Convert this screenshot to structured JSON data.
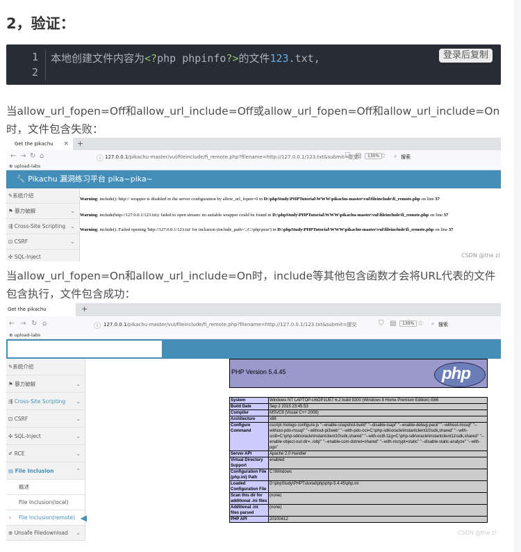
{
  "heading": "2，验证：",
  "code": {
    "line_numbers": [
      "1",
      "2"
    ],
    "text_prefix": "本地创建文件内容为",
    "open_tag": "<?",
    "php_code": "php phpinfo",
    "close_tag": "?>",
    "text_mid": "的文件",
    "file_num": "123",
    "file_ext": ".txt,",
    "copy_label": "登录后复制"
  },
  "para1": "当allow_url_fopen=Off和allow_url_include=Off或allow_url_fopen=Off和allow_url_include=On时，文件包含失败：",
  "para2": "当allow_url_fopen=On和allow_url_include=On时，include等其他包含函数才会将URL代表的文件包含执行，文件包含成功：",
  "shot1": {
    "tab_title": "Get the pikachu",
    "tab_close": "×",
    "tab_plus": "+",
    "url_host": "127.0.0.1",
    "url_path": "/pikachu-master/vul/fileinclude/fi_remote.php?filename=http://127.0.0.1/123.txt&submit=提交",
    "zoom": "130%",
    "search": "搜索",
    "bookmark": "upload-labs",
    "banner": "Pikachu 漏洞练习平台 pika~pika~",
    "sidebar": [
      "系统介绍",
      "暴力破解",
      "Cross-Site Scripting",
      "CSRF",
      "SQL-Inject"
    ],
    "warnings": [
      {
        "label": "Warning",
        "msg": ": include(): http:// wrapper is disabled in the server configuration by allow_url_fopen=0 in ",
        "file": "D:\\phpStudy\\PHPTutorial\\WWW\\pikachu-master\\vul\\fileinclude\\fi_remote.php",
        "line_text": " on line ",
        "line": "37"
      },
      {
        "label": "Warning",
        "msg": ": include(http://127.0.0.1/123.txt): failed to open stream: no suitable wrapper could be found in ",
        "file": "D:\\phpStudy\\PHPTutorial\\WWW\\pikachu-master\\vul\\fileinclude\\fi_remote.php",
        "line_text": " on line ",
        "line": "37"
      },
      {
        "label": "Warning",
        "msg": ": include(): Failed opening 'http://127.0.0.1/123.txt' for inclusion (include_path='.;C:\\php\\pear') in ",
        "file": "D:\\phpStudy\\PHPTutorial\\WWW\\pikachu-master\\vul\\fileinclude\\fi_remote.php",
        "line_text": " on line ",
        "line": "37"
      }
    ],
    "watermark": "CSDN @the zl"
  },
  "shot2": {
    "tab_title": "Get the pikachu",
    "tab_plus": "+",
    "url_host": "127.0.0.1",
    "url_path": "/pikachu-master/vul/fileinclude/fi_remote.php?filename=http://127.0.0.1/123.txt&submit=提交",
    "zoom": "130%",
    "search": "搜索",
    "bookmark": "upload-labs",
    "sidebar": [
      "系统介绍",
      "暴力破解",
      "Cross-Site Scripting",
      "CSRF",
      "SQL-Inject",
      "RCE",
      "File Inclusion"
    ],
    "submenu": [
      "概述",
      "File Inclusion(local)",
      "File Inclusion(remote)"
    ],
    "sidebar_last": "Unsafe Filedownload",
    "php_version": "PHP Version 5.4.45",
    "php_logo": "php",
    "php_rows": [
      {
        "k": "System",
        "v": "Windows NT LAPTOP-U6OP1UE7 6.2 build 9200 (Windows 8 Home Premium Edition) i586"
      },
      {
        "k": "Build Date",
        "v": "Sep 2 2015 23:45:53"
      },
      {
        "k": "Compiler",
        "v": "MSVC9 (Visual C++ 2008)"
      },
      {
        "k": "Architecture",
        "v": "x86"
      },
      {
        "k": "Configure Command",
        "v": "cscript /nologo configure.js \"--enable-snapshot-build\" \"--disable-isapi\" \"--enable-debug-pack\" \"--without-mssql\" \"--without-pdo-mssql\" \"--without-pi3web\" \"--with-pdo-oci=C:\\php-sdk\\oracle\\instantclient10\\sdk,shared\" \"--with-oci8=C:\\php-sdk\\oracle\\instantclient10\\sdk,shared\" \"--with-oci8-11g=C:\\php-sdk\\oracle\\instantclient11\\sdk,shared\" \"--enable-object-out-dir=../obj/\" \"--enable-com-dotnet=shared\" \"--with-mcrypt=static\" \"--disable-static-analyze\" \"--with-pgo\""
      },
      {
        "k": "Server API",
        "v": "Apache 2.0 Handler"
      },
      {
        "k": "Virtual Directory Support",
        "v": "enabled"
      },
      {
        "k": "Configuration File (php.ini) Path",
        "v": "C:\\Windows"
      },
      {
        "k": "Loaded Configuration File",
        "v": "D:\\phpStudy\\PHPTutorial\\php\\php-5.4.45\\php.ini"
      },
      {
        "k": "Scan this dir for additional .ini files",
        "v": "(none)"
      },
      {
        "k": "Additional .ini files parsed",
        "v": "(none)"
      },
      {
        "k": "PHP API",
        "v": "20100412"
      }
    ],
    "watermark": "CSDN @the zl"
  },
  "colors": {
    "banner": "#438eb9",
    "code_bg": "#282c34",
    "php_key": "#ccccff",
    "php_val": "#cccccc",
    "php_head": "#9999cc"
  }
}
